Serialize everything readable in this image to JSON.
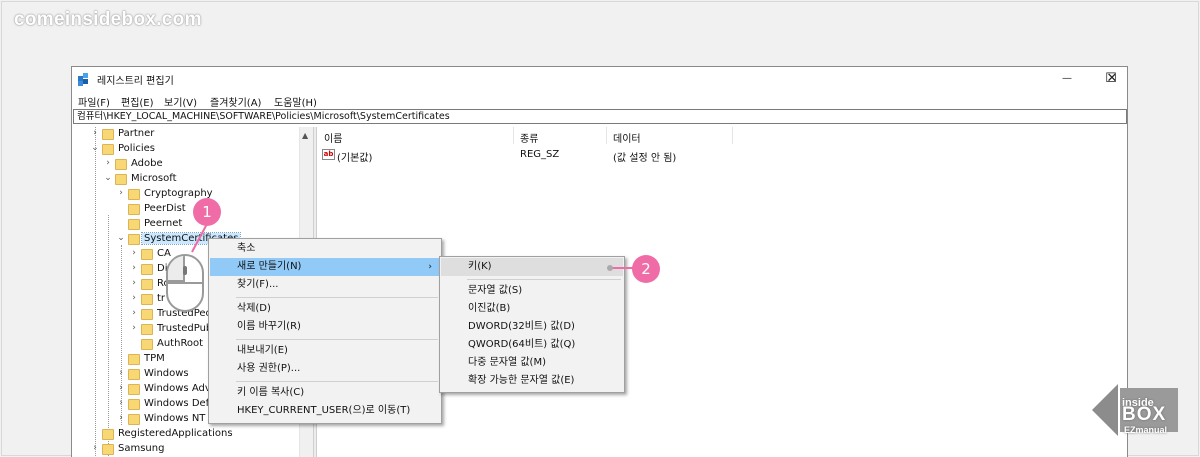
{
  "watermark": "comeinsidebox.com",
  "window": {
    "title": "레지스트리 편집기",
    "controls": {
      "minimize": "—",
      "maximize": "☐",
      "close": "✕"
    }
  },
  "menu": [
    "파일(F)",
    "편집(E)",
    "보기(V)",
    "즐겨찾기(A)",
    "도움말(H)"
  ],
  "address": "컴퓨터\\HKEY_LOCAL_MACHINE\\SOFTWARE\\Policies\\Microsoft\\SystemCertificates",
  "tree": {
    "items": [
      "Partner",
      "Policies",
      "Adobe",
      "Microsoft",
      "Cryptography",
      "PeerDist",
      "Peernet",
      "SystemCertificates",
      "CA",
      "Di",
      "Ro",
      "tr",
      "TrustedPeo",
      "TrustedPub",
      "AuthRoot",
      "TPM",
      "Windows",
      "Windows Adva",
      "Windows Defe",
      "Windows NT",
      "RegisteredApplications",
      "Samsung"
    ]
  },
  "list": {
    "headers": {
      "name": "이름",
      "type": "종류",
      "data": "데이터"
    },
    "rows": [
      {
        "name": "(기본값)",
        "type": "REG_SZ",
        "data": "(값 설정 안 됨)"
      }
    ]
  },
  "context_menu": {
    "items": [
      "축소",
      "새로 만들기(N)",
      "찾기(F)...",
      "삭제(D)",
      "이름 바꾸기(R)",
      "내보내기(E)",
      "사용 권한(P)...",
      "키 이름 복사(C)",
      "HKEY_CURRENT_USER(으)로 이동(T)"
    ],
    "submenu_arrow": "›"
  },
  "submenu": {
    "items": [
      "키(K)",
      "문자열 값(S)",
      "이진값(B)",
      "DWORD(32비트) 값(D)",
      "QWORD(64비트) 값(Q)",
      "다중 문자열 값(M)",
      "확장 가능한 문자열 값(E)"
    ]
  },
  "annotations": {
    "step1": "1",
    "step2": "2"
  },
  "logo": {
    "line1": "inside",
    "line2": "BOX",
    "line3": "EZmanual"
  },
  "icons": {
    "folder": "folder-icon",
    "expand": "chevron-right-icon",
    "collapse": "chevron-down-icon",
    "string_value": "ab-value-icon"
  },
  "colors": {
    "selection": "#cce8ff",
    "menu_highlight": "#91c9f7",
    "badge": "#f06ca6",
    "folder": "#f8d775"
  }
}
